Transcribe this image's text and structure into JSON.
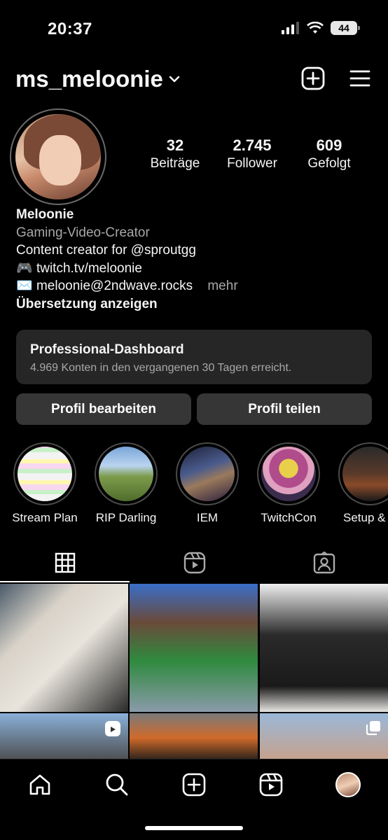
{
  "status_bar": {
    "time": "20:37",
    "battery": "44"
  },
  "header": {
    "username": "ms_meloonie"
  },
  "stats": [
    {
      "count": "32",
      "label": "Beiträge"
    },
    {
      "count": "2.745",
      "label": "Follower"
    },
    {
      "count": "609",
      "label": "Gefolgt"
    }
  ],
  "bio": {
    "name": "Meloonie",
    "category": "Gaming-Video-Creator",
    "line1": "Content creator for @sproutgg",
    "line2_emoji": "🎮",
    "line2": "twitch.tv/meloonie",
    "line3_emoji": "✉️",
    "line3": "meloonie@2ndwave.rocks",
    "more": "mehr",
    "translate": "Übersetzung anzeigen"
  },
  "dashboard": {
    "title": "Professional-Dashboard",
    "subtitle": "4.969 Konten in den vergangenen 30 Tagen erreicht."
  },
  "buttons": {
    "edit": "Profil bearbeiten",
    "share": "Profil teilen"
  },
  "highlights": [
    {
      "label": "Stream Plan"
    },
    {
      "label": "RIP Darling"
    },
    {
      "label": "IEM"
    },
    {
      "label": "TwitchCon"
    },
    {
      "label": "Setup & G"
    }
  ],
  "tabs": {
    "active": "grid-icon"
  },
  "colors": {
    "background": "#000000",
    "surface": "#262626",
    "button": "#363636",
    "muted": "#a8a8a8"
  }
}
